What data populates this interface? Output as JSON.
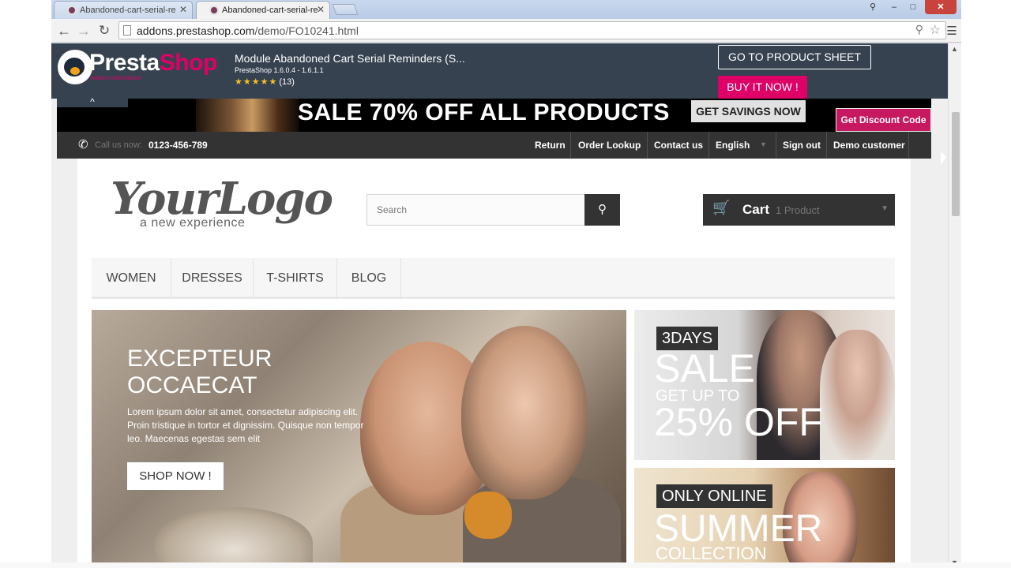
{
  "browser": {
    "tabs": [
      {
        "label": "Abandoned-cart-serial-re",
        "active": false
      },
      {
        "label": "Abandoned-cart-serial-re",
        "active": true
      }
    ],
    "url_host": "addons.prestashop.com",
    "url_path": "/demo/FO10241.html",
    "window_controls": {
      "minimize": "–",
      "maximize": "□",
      "close": "✕",
      "user": "⚲"
    }
  },
  "addons_header": {
    "brand_presta": "Presta",
    "brand_shop": "Shop",
    "brand_tagline": "Addons Marketplace",
    "module_title": "Module Abandoned Cart Serial Reminders (S...",
    "module_version": "PrestaShop 1.6.0.4 - 1.6.1.1",
    "rating_stars": "★★★★★",
    "rating_count": "(13)",
    "go_to_sheet": "GO TO PRODUCT SHEET",
    "buy_now": "BUY IT NOW !",
    "collapse_glyph": "^"
  },
  "sale_banner": {
    "text": "SALE 70% OFF ALL PRODUCTS",
    "savings_button": "GET SAVINGS NOW",
    "discount_button": "Get Discount Code"
  },
  "topbar": {
    "call_label": "Call us now:",
    "phone": "0123-456-789",
    "links": [
      "Return",
      "Order Lookup",
      "Contact us",
      "English",
      "Sign out",
      "Demo customer"
    ]
  },
  "header": {
    "logo_main": "YourLogo",
    "logo_sub": "a new experience",
    "search_placeholder": "Search",
    "cart_label": "Cart",
    "cart_count": "1 Product"
  },
  "menu": [
    "WOMEN",
    "DRESSES",
    "T-SHIRTS",
    "BLOG"
  ],
  "hero": {
    "title": "EXCEPTEUR OCCAECAT",
    "body": "Lorem ipsum dolor sit amet, consectetur adipiscing elit. Proin tristique in tortor et dignissim. Quisque non tempor leo. Maecenas egestas sem elit",
    "button": "SHOP NOW !"
  },
  "promo_sale": {
    "tag": "3DAYS",
    "sale": "SALE",
    "get_up_to": "GET UP TO",
    "discount": "25% OFF"
  },
  "promo_summer": {
    "tag": "ONLY ONLINE",
    "title": "SUMMER",
    "subtitle": "COLLECTION"
  },
  "colors": {
    "brand_pink": "#df0067",
    "addons_bar": "#364250",
    "dark_bar": "#333333"
  }
}
